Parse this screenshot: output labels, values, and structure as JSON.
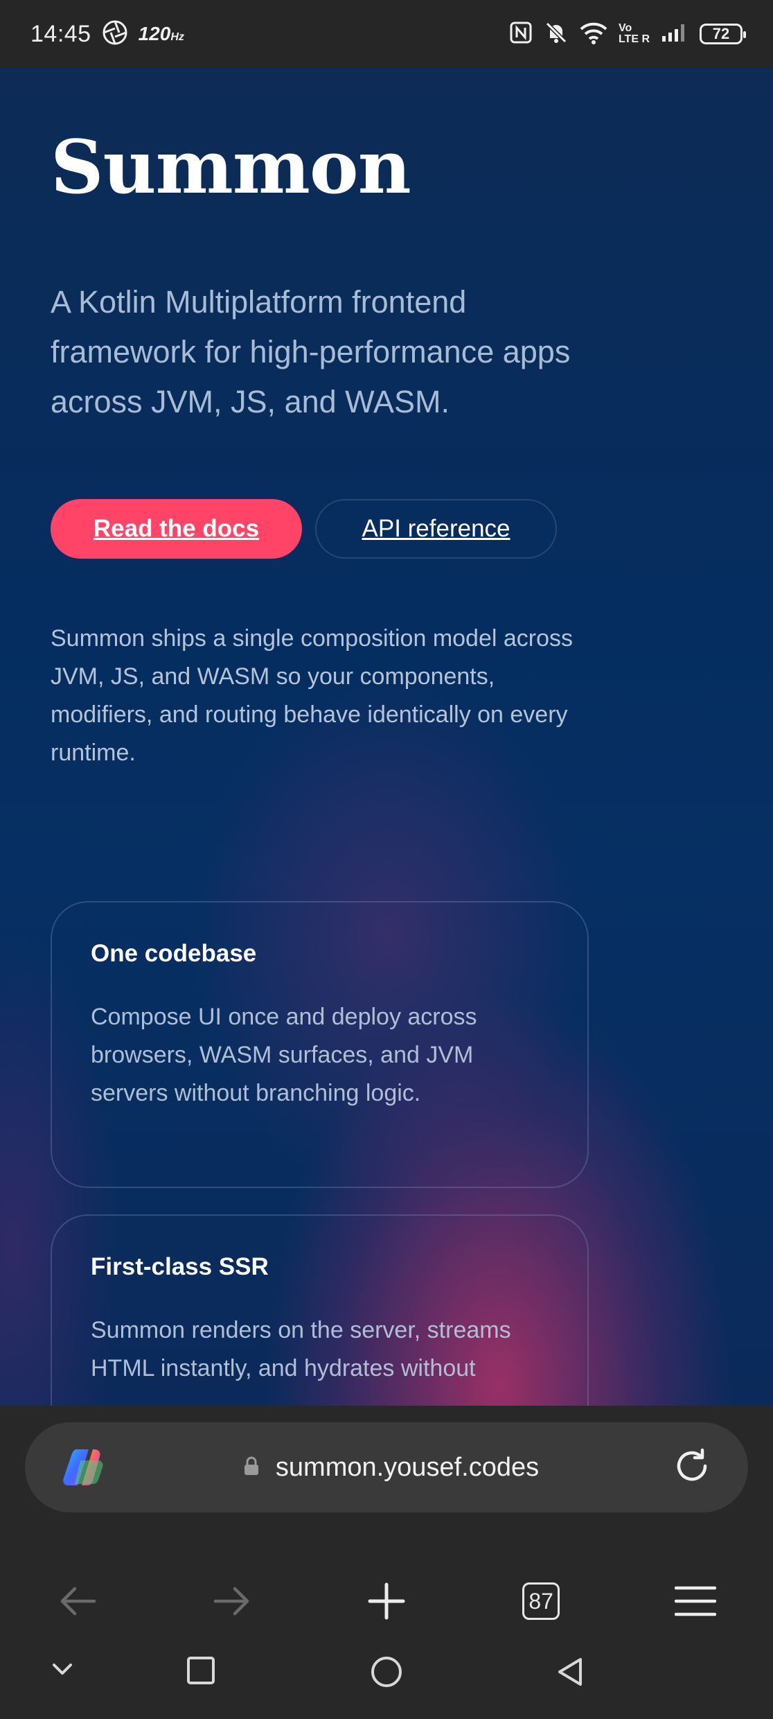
{
  "status_bar": {
    "time": "14:45",
    "refresh_rate": "120",
    "refresh_unit": "Hz",
    "network_vo": "Vo",
    "network_lte": "LTE R",
    "battery_level": "72"
  },
  "hero": {
    "title": "Summon",
    "subtitle": "A Kotlin Multiplatform frontend framework for high-performance apps across JVM, JS, and WASM.",
    "primary_button": "Read the docs",
    "secondary_button": "API reference",
    "description": "Summon ships a single composition model across JVM, JS, and WASM so your components, modifiers, and routing behave identically on every runtime."
  },
  "cards": [
    {
      "title": "One codebase",
      "text": "Compose UI once and deploy across browsers, WASM surfaces, and JVM servers without branching logic."
    },
    {
      "title": "First-class SSR",
      "text": "Summon renders on the server, streams HTML instantly, and hydrates without"
    }
  ],
  "browser": {
    "url": "summon.yousef.codes",
    "tab_count": "87"
  },
  "colors": {
    "accent": "#ff4468",
    "page_background": "#052d5f",
    "chrome_background": "#282828"
  }
}
